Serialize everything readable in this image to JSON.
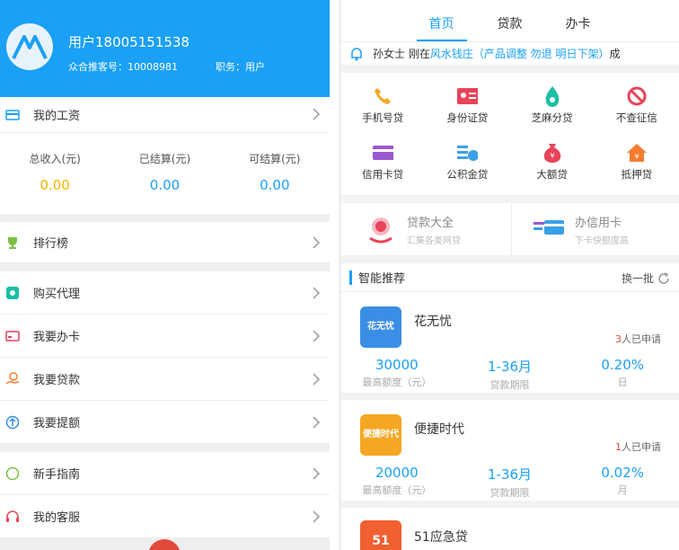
{
  "left": {
    "profile": {
      "username": "用户18005151538",
      "referral_label": "众合推客号：10008981",
      "role_label": "职务：用户"
    },
    "salary": {
      "title": "我的工资",
      "cols": [
        {
          "label": "总收入(元)",
          "value": "0.00",
          "color": "#f5b400"
        },
        {
          "label": "已结算(元)",
          "value": "0.00",
          "color": "#1aa0f5"
        },
        {
          "label": "可结算(元)",
          "value": "0.00",
          "color": "#1aa0f5"
        }
      ]
    },
    "menu": {
      "ranking": "排行榜",
      "buy_agent": "购买代理",
      "apply_card": "我要办卡",
      "apply_loan": "我要贷款",
      "raise_limit": "我要提额",
      "guide": "新手指南",
      "service": "我的客服"
    }
  },
  "right": {
    "tabs": [
      "首页",
      "贷款",
      "办卡"
    ],
    "notice": {
      "pre": "孙女士 刚在",
      "hl": "风水钱庄（产品调整 勿退 明日下架）",
      "post": "成"
    },
    "grid": [
      {
        "label": "手机号贷",
        "icon": "phone-icon",
        "color": "#f5a623"
      },
      {
        "label": "身份证贷",
        "icon": "id-card-icon",
        "color": "#e8445a"
      },
      {
        "label": "芝麻分贷",
        "icon": "sesame-icon",
        "color": "#1cbfa5"
      },
      {
        "label": "不查征信",
        "icon": "no-credit-icon",
        "color": "#e8445a"
      },
      {
        "label": "信用卡贷",
        "icon": "credit-card-icon",
        "color": "#9b59d0"
      },
      {
        "label": "公积金贷",
        "icon": "fund-icon",
        "color": "#3aa0e8"
      },
      {
        "label": "大额贷",
        "icon": "money-bag-icon",
        "color": "#e8445a"
      },
      {
        "label": "抵押贷",
        "icon": "house-icon",
        "color": "#f57c30"
      }
    ],
    "promo": [
      {
        "title": "贷款大全",
        "sub": "汇集各类网贷"
      },
      {
        "title": "办信用卡",
        "sub": "下卡快额度高"
      }
    ],
    "reco": {
      "title": "智能推荐",
      "switch": "换一批",
      "items": [
        {
          "name": "花无忧",
          "logo_text": "花无忧",
          "logo_color": "#3a8ee6",
          "count": "3",
          "suffix": "人已申请",
          "amount": "30000",
          "amount_lbl": "最高额度（元）",
          "term": "1-36月",
          "term_lbl": "贷款期限",
          "rate": "0.20%",
          "rate_lbl": "日"
        },
        {
          "name": "便捷时代",
          "logo_text": "便捷时代",
          "logo_color": "#f5a623",
          "count": "1",
          "suffix": "人已申请",
          "amount": "20000",
          "amount_lbl": "最高额度（元）",
          "term": "1-36月",
          "term_lbl": "贷款期限",
          "rate": "0.02%",
          "rate_lbl": "月"
        },
        {
          "name": "51应急贷",
          "logo_text": "51",
          "logo_color": "#f06030"
        }
      ]
    }
  }
}
